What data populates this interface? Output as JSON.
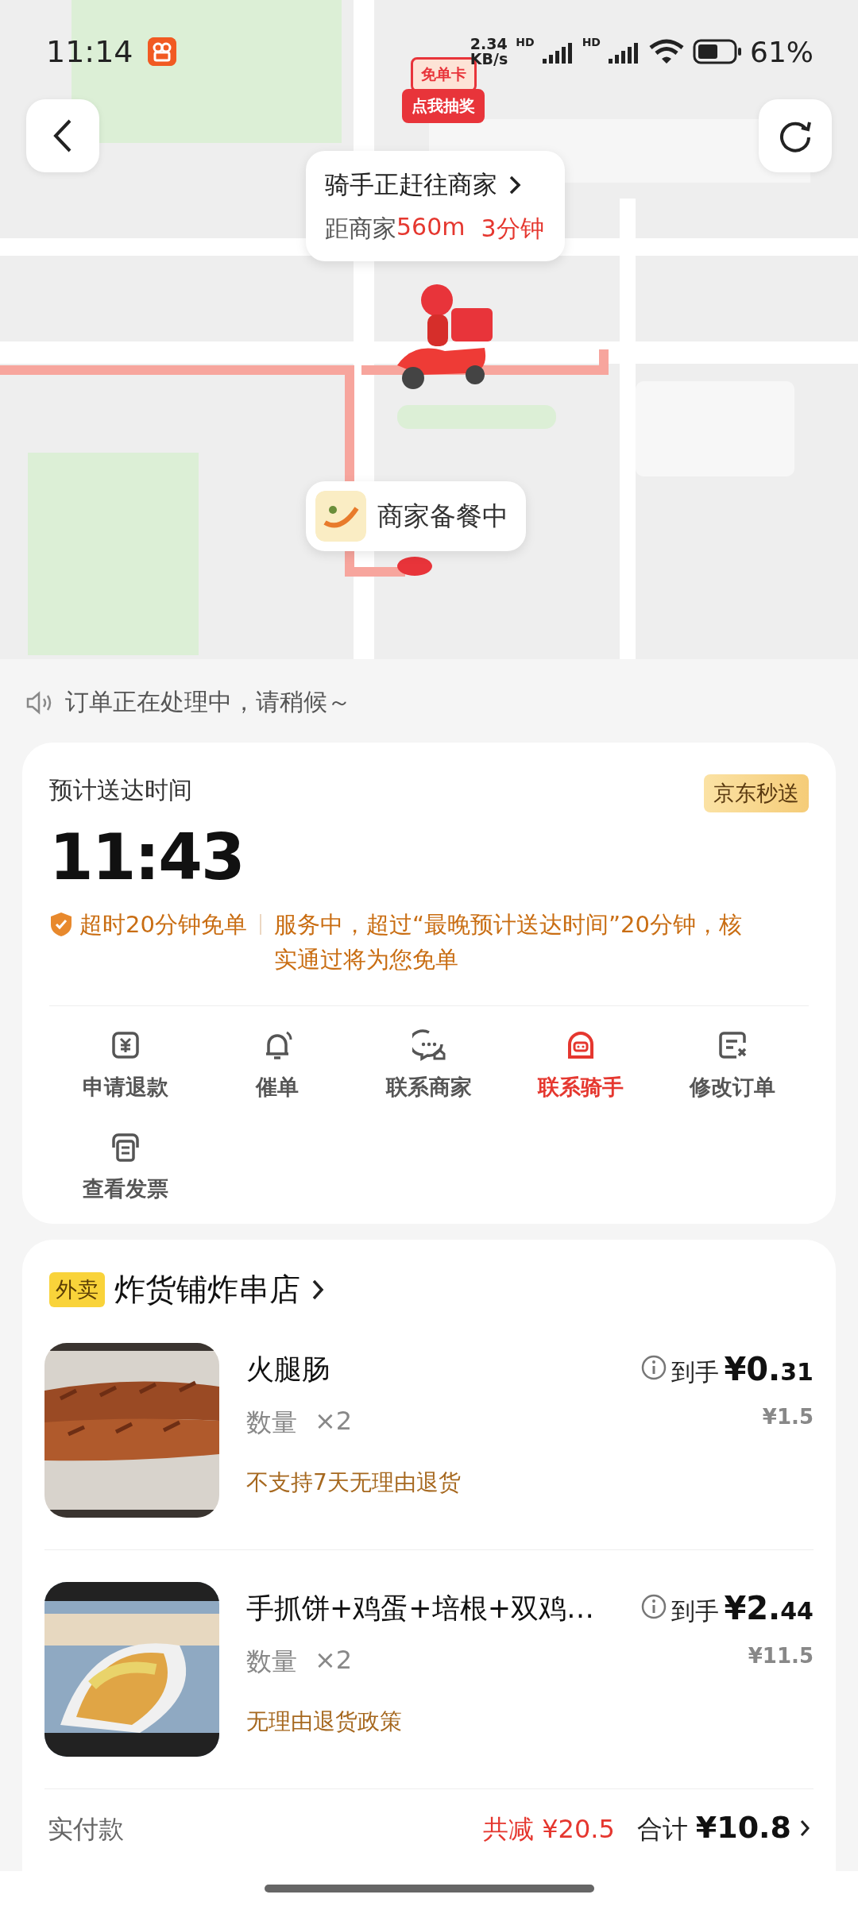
{
  "status_bar": {
    "time": "11:14",
    "net_speed": "2.34",
    "net_unit": "KB/s",
    "signal_labels": [
      "HD",
      "HD"
    ],
    "battery": "61%"
  },
  "map": {
    "promo": {
      "top": "免单卡",
      "bottom": "点我抽奖"
    },
    "rider_bubble": {
      "title": "骑手正赶往商家",
      "distance_label": "距商家",
      "distance": "560m",
      "eta": "3分钟"
    },
    "merchant_bubble": {
      "status": "商家备餐中"
    }
  },
  "notice": "订单正在处理中，请稍候～",
  "delivery": {
    "label": "预计送达时间",
    "time": "11:43",
    "service_tag": "京东秒送",
    "guarantee": "超时20分钟免单",
    "guarantee_detail": "服务中，超过“最晚预计送达时间”20分钟，核实通过将为您免单"
  },
  "actions": [
    {
      "kind": "refund",
      "label": "申请退款",
      "highlighted": false
    },
    {
      "kind": "bell",
      "label": "催单",
      "highlighted": false
    },
    {
      "kind": "store-chat",
      "label": "联系商家",
      "highlighted": false
    },
    {
      "kind": "rider",
      "label": "联系骑手",
      "highlighted": true
    },
    {
      "kind": "edit",
      "label": "修改订单",
      "highlighted": false
    },
    {
      "kind": "invoice",
      "label": "查看发票",
      "highlighted": false
    }
  ],
  "store": {
    "tag": "外卖",
    "name": "炸货铺炸串店"
  },
  "items": [
    {
      "kind": "skewer",
      "name": "火腿肠",
      "quantity_label": "数量",
      "quantity": "×2",
      "price_label": "到手",
      "price": "¥0.31",
      "original_price": "¥1.5",
      "policy": "不支持7天无理由退货"
    },
    {
      "kind": "wrap",
      "name": "手抓饼+鸡蛋+培根+双鸡…",
      "quantity_label": "数量",
      "quantity": "×2",
      "price_label": "到手",
      "price": "¥2.44",
      "original_price": "¥11.5",
      "policy": "无理由退货政策"
    }
  ],
  "summary": {
    "label": "实付款",
    "discount_label": "共减",
    "discount": "¥20.5",
    "total_label": "合计",
    "total": "¥10.8"
  }
}
